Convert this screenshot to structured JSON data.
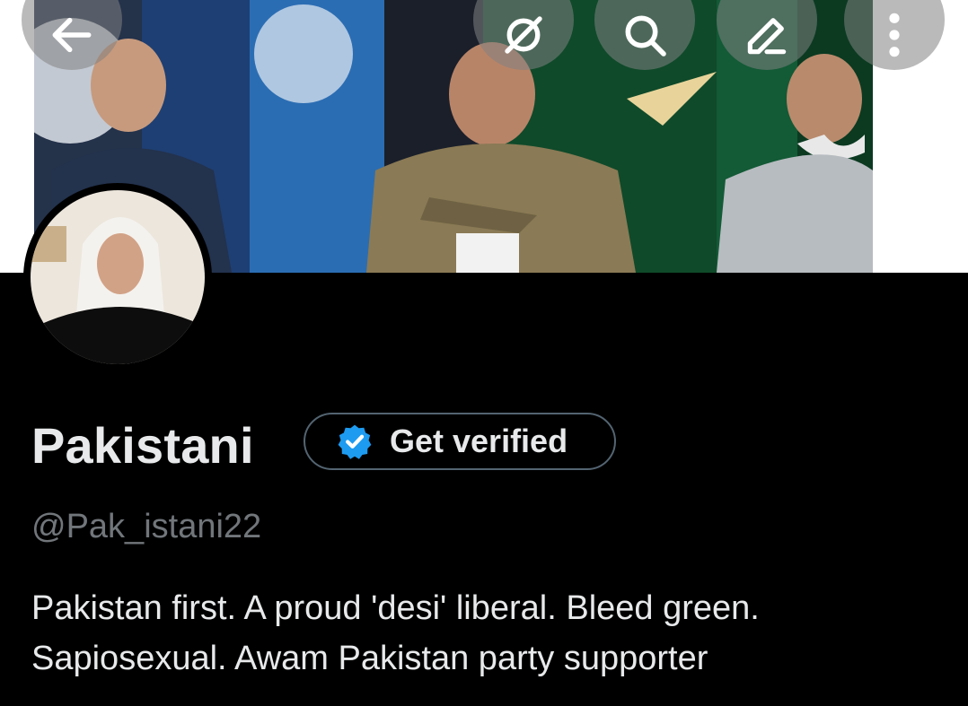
{
  "header": {
    "buttons": [
      {
        "name": "back-button",
        "icon": "arrow-left-icon"
      },
      {
        "name": "grok-button",
        "icon": "grok-icon"
      },
      {
        "name": "search-button",
        "icon": "search-icon"
      },
      {
        "name": "edit-button",
        "icon": "pencil-icon"
      },
      {
        "name": "more-button",
        "icon": "more-vertical-icon"
      }
    ]
  },
  "profile": {
    "display_name": "Pakistani",
    "verify_label": "Get verified",
    "handle": "@Pak_istani22",
    "bio_line1": "Pakistan first. A proud 'desi' liberal. Bleed green.",
    "bio_line2": "Sapiosexual. Awam Pakistan party supporter"
  },
  "colors": {
    "background": "#000000",
    "verified_badge": "#1d9bf0",
    "muted_text": "#71767b",
    "button_border": "#536471"
  }
}
